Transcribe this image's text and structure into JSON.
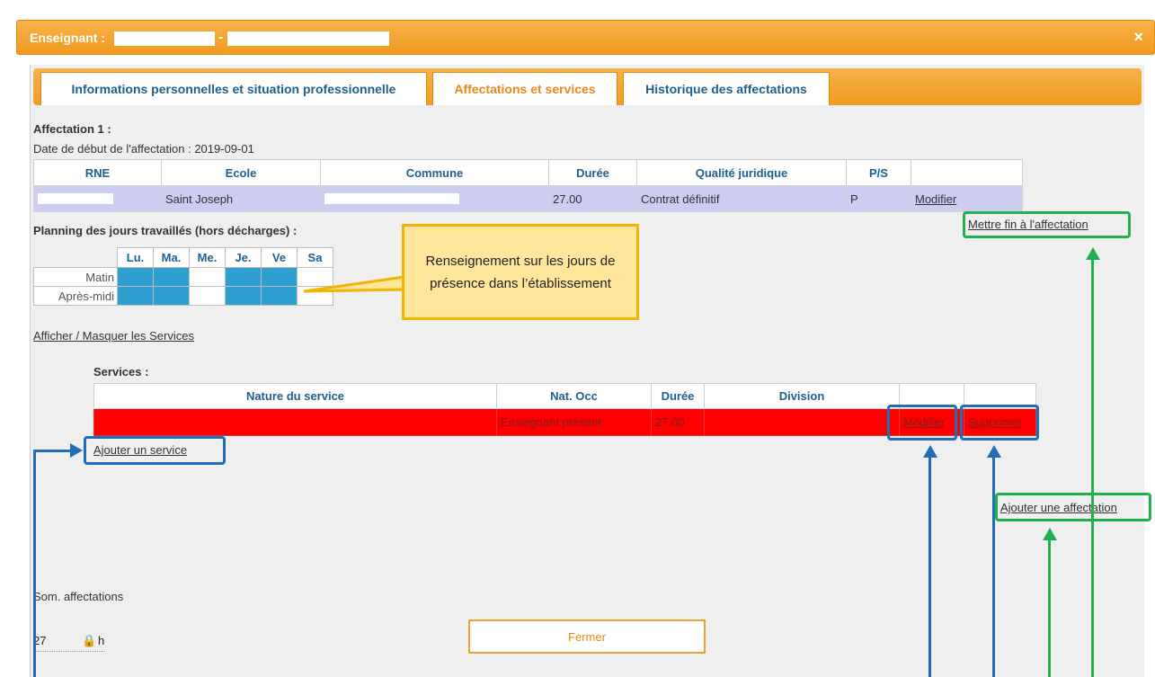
{
  "dialog": {
    "title": "Enseignant :",
    "close": "×"
  },
  "tabs": [
    {
      "label": "Informations personnelles et situation professionnelle"
    },
    {
      "label": "Affectations et services"
    },
    {
      "label": "Historique des affectations"
    }
  ],
  "affectation": {
    "heading": "Affectation 1 :",
    "start_date": "Date de début de l'affectation : 2019-09-01",
    "columns": [
      "RNE",
      "Ecole",
      "Commune",
      "Durée",
      "Qualité juridique",
      "P/S",
      ""
    ],
    "row": {
      "rne": "",
      "ecole": "Saint Joseph",
      "commune": "",
      "duree": "27.00",
      "qualite": "Contrat définitif",
      "ps": "P",
      "action": "Modifier"
    }
  },
  "planning": {
    "heading": "Planning des jours travaillés (hors décharges) :",
    "days": [
      "Lu.",
      "Ma.",
      "Me.",
      "Je.",
      "Ve",
      "Sa"
    ],
    "rows": [
      {
        "label": "Matin"
      },
      {
        "label": "Après-midi"
      }
    ]
  },
  "links": {
    "end_affectation": "Mettre fin à l'affectation",
    "toggle_services": "Afficher / Masquer les Services",
    "add_service": "Ajouter un service",
    "add_affectation": "Ajouter une affectation"
  },
  "callout": {
    "text": "Renseignement sur les jours de présence dans l’établissement"
  },
  "services": {
    "heading": "Services :",
    "columns": [
      "Nature du service",
      "Nat. Occ",
      "Durée",
      "Division",
      "",
      ""
    ],
    "row": {
      "nature": "",
      "nat_occ": "Enseignant présent",
      "duree": "27.00",
      "division": "",
      "modify": "Modifier",
      "delete": "Supprimer"
    }
  },
  "summary": {
    "label": "Som. affectations",
    "value": "27",
    "unit": "h"
  },
  "footer": {
    "close": "Fermer"
  },
  "colors": {
    "orange": "#f19a1f",
    "blue": "#1f6fb6",
    "green": "#20b050",
    "service_row": "#ff0000"
  }
}
